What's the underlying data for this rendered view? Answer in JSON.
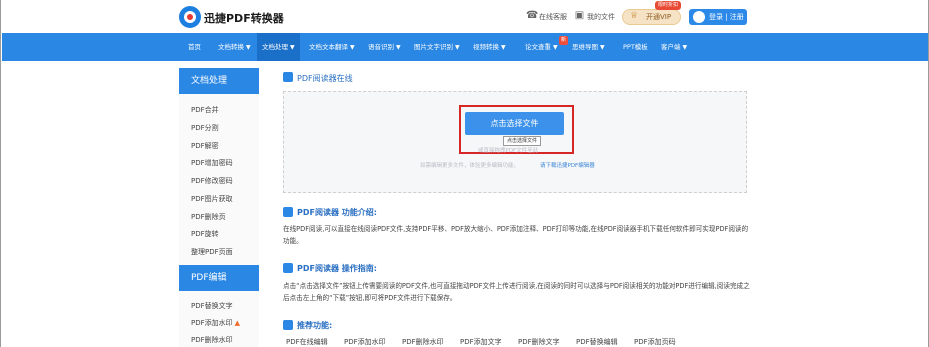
{
  "header": {
    "brand": "迅捷PDF转换器",
    "service_label": "在线客服",
    "myfiles_label": "我的文件",
    "vip_label": "开通VIP",
    "vip_badge": "限时折扣",
    "login_label": "登录 | 注册"
  },
  "nav": {
    "items": [
      {
        "label": "首页",
        "caret": false
      },
      {
        "label": "文档转换",
        "caret": true
      },
      {
        "label": "文档处理",
        "caret": true
      },
      {
        "label": "文档文本翻译",
        "caret": true
      },
      {
        "label": "语音识别",
        "caret": true
      },
      {
        "label": "图片文字识别",
        "caret": true
      },
      {
        "label": "视频转换",
        "caret": true
      },
      {
        "label": "论文查重",
        "caret": true
      },
      {
        "label": "思维导图",
        "caret": true
      },
      {
        "label": "PPT模板",
        "caret": false
      },
      {
        "label": "客户端",
        "caret": true
      }
    ],
    "new_badge": "新"
  },
  "sidebar": {
    "head1": "文档处理",
    "items1": [
      "PDF合并",
      "PDF分割",
      "PDF解密",
      "PDF增加密码",
      "PDF修改密码",
      "PDF图片获取",
      "PDF删除页",
      "PDF旋转",
      "整理PDF页面"
    ],
    "head2": "PDF编辑",
    "items2": [
      "PDF替换文字",
      "PDF添加水印",
      "PDF删除水印"
    ]
  },
  "main": {
    "section_title": "PDF阅读器在线",
    "upload": {
      "button_label": "点击选择文件",
      "tooltip": "点击选择文件",
      "hint_line1": "或直接拖拽PDF文件至此",
      "hint_line2": "如需编辑更多文件，体验更多编辑功能，",
      "hint_link": "请下载迅捷PDF编辑器"
    },
    "intro_title": "PDF阅读器 功能介绍:",
    "intro_text": "在线PDF阅读,可以直接在线阅读PDF文件,支持PDF平移、PDF放大缩小、PDF添加注释、PDF打印等功能,在线PDF阅读器手机下载任何软件即可实现PDF阅读的功能。",
    "guide_title": "PDF阅读器 操作指南:",
    "guide_text": "点击“点击选择文件”按钮上传需要阅读的PDF文件,也可直接拖动PDF文件上传进行阅读,在阅读的同时可以选择与PDF阅读相关的功能对PDF进行编辑,阅读完成之后点击左上角的“下载”按钮,即可将PDF文件进行下载保存。",
    "recommend_title": "推荐功能:",
    "recommend_items": [
      "PDF在线编辑",
      "PDF添加水印",
      "PDF删除水印",
      "PDF添加文字",
      "PDF删除文字",
      "PDF替换编辑",
      "PDF添加页码"
    ]
  },
  "colors": {
    "nav_blue": "#2a87e4",
    "nav_active": "#1a6fc8",
    "highlight_red": "#d62626",
    "button_blue": "#3c92ea"
  }
}
